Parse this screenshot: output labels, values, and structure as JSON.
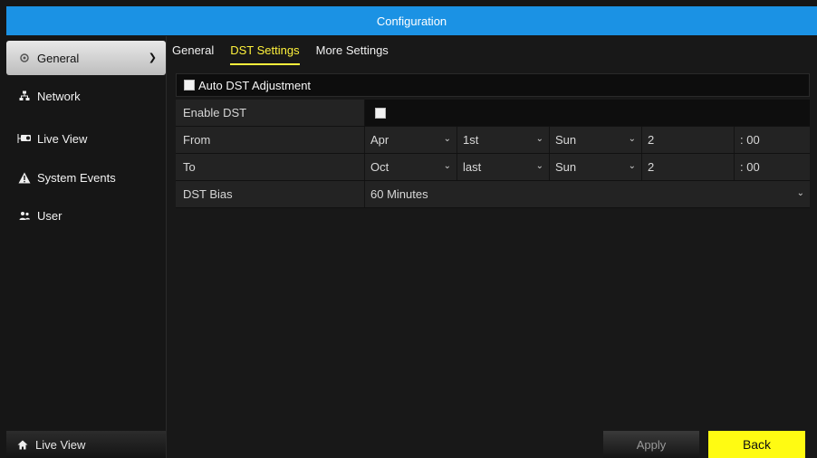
{
  "title": "Configuration",
  "sidebar": {
    "items": [
      {
        "label": "General",
        "icon": "gear-icon",
        "active": true
      },
      {
        "label": "Network",
        "icon": "network-icon"
      },
      {
        "label": "Live View",
        "icon": "camera-icon"
      },
      {
        "label": "System Events",
        "icon": "warning-icon"
      },
      {
        "label": "User",
        "icon": "users-icon"
      }
    ],
    "bottom": {
      "label": "Live View",
      "icon": "home-icon"
    }
  },
  "tabs": [
    {
      "label": "General"
    },
    {
      "label": "DST Settings",
      "active": true
    },
    {
      "label": "More Settings"
    }
  ],
  "auto_dst": {
    "label": "Auto DST Adjustment",
    "checked": false
  },
  "form": {
    "enable": {
      "label": "Enable DST",
      "checked": false
    },
    "from": {
      "label": "From",
      "month": "Apr",
      "week": "1st",
      "day": "Sun",
      "hour": "2",
      "minute": ": 00"
    },
    "to": {
      "label": "To",
      "month": "Oct",
      "week": "last",
      "day": "Sun",
      "hour": "2",
      "minute": ": 00"
    },
    "bias": {
      "label": "DST Bias",
      "value": "60 Minutes"
    }
  },
  "buttons": {
    "apply": "Apply",
    "back": "Back"
  },
  "colors": {
    "accent": "#1b92e4",
    "tab_active": "#fff23c",
    "back_button": "#fffb12"
  }
}
